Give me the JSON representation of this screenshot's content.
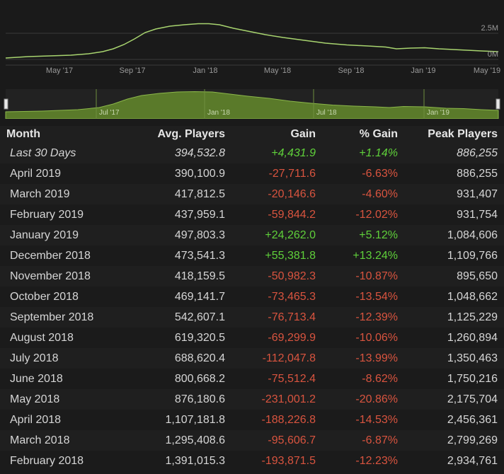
{
  "chart": {
    "x_labels": [
      "May '17",
      "Sep '17",
      "Jan '18",
      "May '18",
      "Sep '18",
      "Jan '19",
      "May '19"
    ],
    "y_labels": [
      "2.5M",
      "0M"
    ],
    "nav_labels": [
      "Jul '17",
      "Jan '18",
      "Jul '18",
      "Jan '19"
    ],
    "line_color": "#a8d46f",
    "nav_fill_color": "#5a7a2a"
  },
  "table": {
    "headers": {
      "month": "Month",
      "avg": "Avg. Players",
      "gain": "Gain",
      "pct": "% Gain",
      "peak": "Peak Players"
    },
    "rows": [
      {
        "month": "Last 30 Days",
        "avg": "394,532.8",
        "gain": "+4,431.9",
        "pct": "+1.14%",
        "peak": "886,255",
        "trend": "pos",
        "italic": true
      },
      {
        "month": "April 2019",
        "avg": "390,100.9",
        "gain": "-27,711.6",
        "pct": "-6.63%",
        "peak": "886,255",
        "trend": "neg"
      },
      {
        "month": "March 2019",
        "avg": "417,812.5",
        "gain": "-20,146.6",
        "pct": "-4.60%",
        "peak": "931,407",
        "trend": "neg"
      },
      {
        "month": "February 2019",
        "avg": "437,959.1",
        "gain": "-59,844.2",
        "pct": "-12.02%",
        "peak": "931,754",
        "trend": "neg"
      },
      {
        "month": "January 2019",
        "avg": "497,803.3",
        "gain": "+24,262.0",
        "pct": "+5.12%",
        "peak": "1,084,606",
        "trend": "pos"
      },
      {
        "month": "December 2018",
        "avg": "473,541.3",
        "gain": "+55,381.8",
        "pct": "+13.24%",
        "peak": "1,109,766",
        "trend": "pos"
      },
      {
        "month": "November 2018",
        "avg": "418,159.5",
        "gain": "-50,982.3",
        "pct": "-10.87%",
        "peak": "895,650",
        "trend": "neg"
      },
      {
        "month": "October 2018",
        "avg": "469,141.7",
        "gain": "-73,465.3",
        "pct": "-13.54%",
        "peak": "1,048,662",
        "trend": "neg"
      },
      {
        "month": "September 2018",
        "avg": "542,607.1",
        "gain": "-76,713.4",
        "pct": "-12.39%",
        "peak": "1,125,229",
        "trend": "neg"
      },
      {
        "month": "August 2018",
        "avg": "619,320.5",
        "gain": "-69,299.9",
        "pct": "-10.06%",
        "peak": "1,260,894",
        "trend": "neg"
      },
      {
        "month": "July 2018",
        "avg": "688,620.4",
        "gain": "-112,047.8",
        "pct": "-13.99%",
        "peak": "1,350,463",
        "trend": "neg"
      },
      {
        "month": "June 2018",
        "avg": "800,668.2",
        "gain": "-75,512.4",
        "pct": "-8.62%",
        "peak": "1,750,216",
        "trend": "neg"
      },
      {
        "month": "May 2018",
        "avg": "876,180.6",
        "gain": "-231,001.2",
        "pct": "-20.86%",
        "peak": "2,175,704",
        "trend": "neg"
      },
      {
        "month": "April 2018",
        "avg": "1,107,181.8",
        "gain": "-188,226.8",
        "pct": "-14.53%",
        "peak": "2,456,361",
        "trend": "neg"
      },
      {
        "month": "March 2018",
        "avg": "1,295,408.6",
        "gain": "-95,606.7",
        "pct": "-6.87%",
        "peak": "2,799,269",
        "trend": "neg"
      },
      {
        "month": "February 2018",
        "avg": "1,391,015.3",
        "gain": "-193,871.5",
        "pct": "-12.23%",
        "peak": "2,934,761",
        "trend": "neg"
      }
    ]
  }
}
